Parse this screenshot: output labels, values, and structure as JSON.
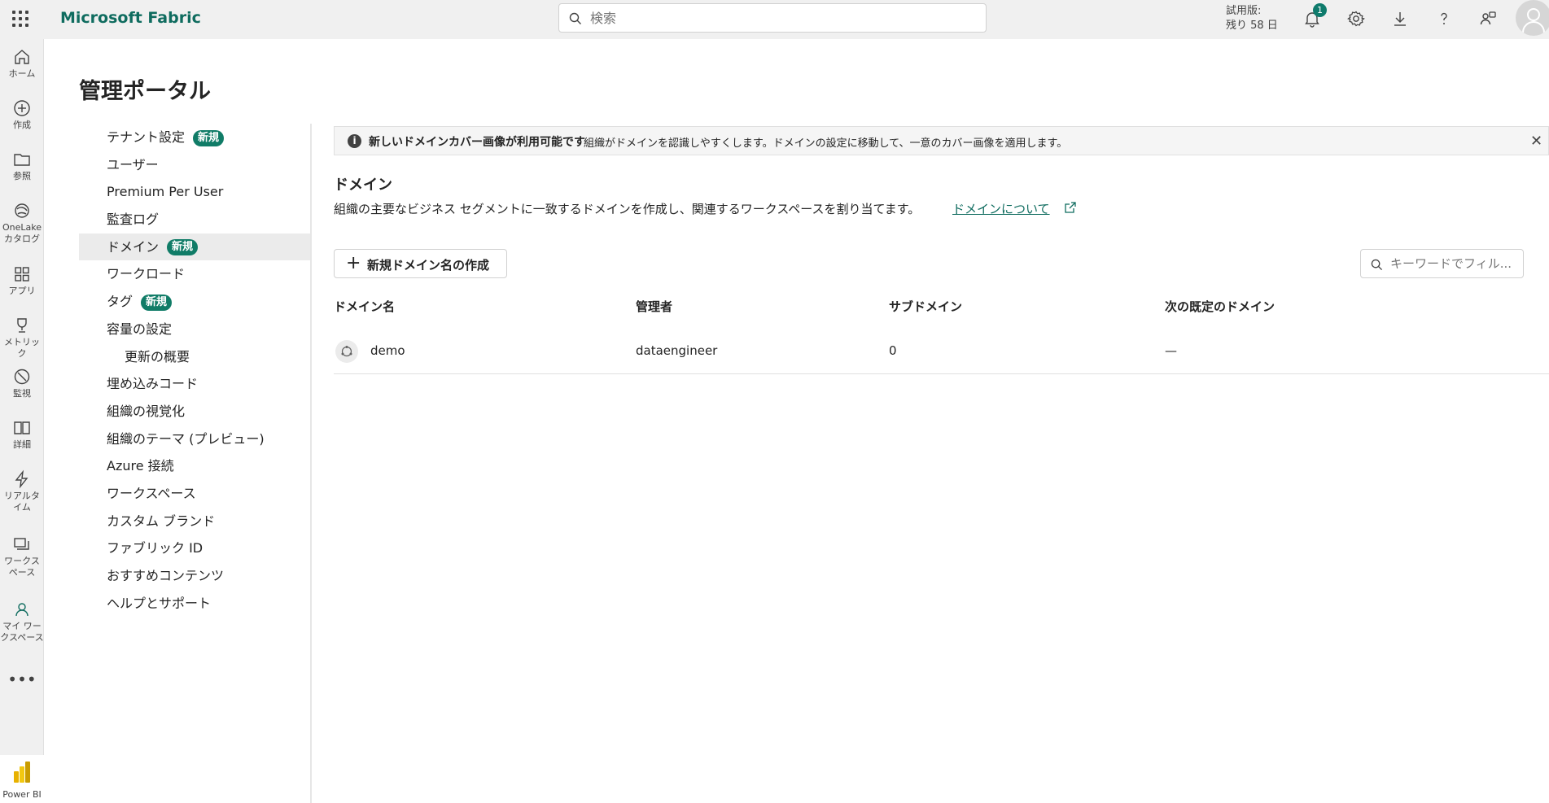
{
  "app": {
    "title": "Microsoft Fabric",
    "search_placeholder": "検索",
    "trial_line1": "試用版:",
    "trial_line2": "残り 58 日",
    "notification_count": "1"
  },
  "leftnav": [
    {
      "label": "ホーム",
      "icon": "home-icon"
    },
    {
      "label": "作成",
      "icon": "create-icon"
    },
    {
      "label": "参照",
      "icon": "browse-icon"
    },
    {
      "label": "OneLake カタログ",
      "icon": "onelake-icon"
    },
    {
      "label": "アプリ",
      "icon": "apps-icon"
    },
    {
      "label": "メトリック",
      "icon": "metrics-icon"
    },
    {
      "label": "監視",
      "icon": "monitor-icon"
    },
    {
      "label": "詳細",
      "icon": "learn-icon"
    },
    {
      "label": "リアルタイム",
      "icon": "realtime-icon"
    },
    {
      "label": "ワークスペース",
      "icon": "workspaces-icon"
    },
    {
      "label": "マイ ワークスペース",
      "icon": "my-workspace-icon"
    }
  ],
  "powerbi_label": "Power BI",
  "page_title": "管理ポータル",
  "settings_nav": [
    {
      "label": "テナント設定",
      "badge": "新規"
    },
    {
      "label": "ユーザー"
    },
    {
      "label": "Premium Per User"
    },
    {
      "label": "監査ログ"
    },
    {
      "label": "ドメイン",
      "badge": "新規",
      "selected": true
    },
    {
      "label": "ワークロード"
    },
    {
      "label": "タグ",
      "badge": "新規"
    },
    {
      "label": "容量の設定"
    },
    {
      "label": "更新の概要",
      "sub": true
    },
    {
      "label": "埋め込みコード"
    },
    {
      "label": "組織の視覚化"
    },
    {
      "label": "組織のテーマ (プレビュー)"
    },
    {
      "label": "Azure 接続"
    },
    {
      "label": "ワークスペース"
    },
    {
      "label": "カスタム ブランド"
    },
    {
      "label": "ファブリック ID"
    },
    {
      "label": "おすすめコンテンツ"
    },
    {
      "label": "ヘルプとサポート"
    }
  ],
  "banner": {
    "title": "新しいドメインカバー画像が利用可能です",
    "message": "組織がドメインを認識しやすくします。ドメインの設定に移動して、一意のカバー画像を適用します。"
  },
  "domains": {
    "title": "ドメイン",
    "description": "組織の主要なビジネス セグメントに一致するドメインを作成し、関連するワークスペースを割り当てます。",
    "link": "ドメインについて",
    "new_button": "新規ドメイン名の作成",
    "filter_placeholder": "キーワードでフィル...",
    "columns": [
      "ドメイン名",
      "管理者",
      "サブドメイン",
      "次の既定のドメイン"
    ],
    "rows": [
      {
        "name": "demo",
        "admin": "dataengineer",
        "subdomains": "0",
        "default_for": "—"
      }
    ]
  },
  "colors": {
    "brand": "#0f6c5f",
    "badge": "#107c67"
  }
}
